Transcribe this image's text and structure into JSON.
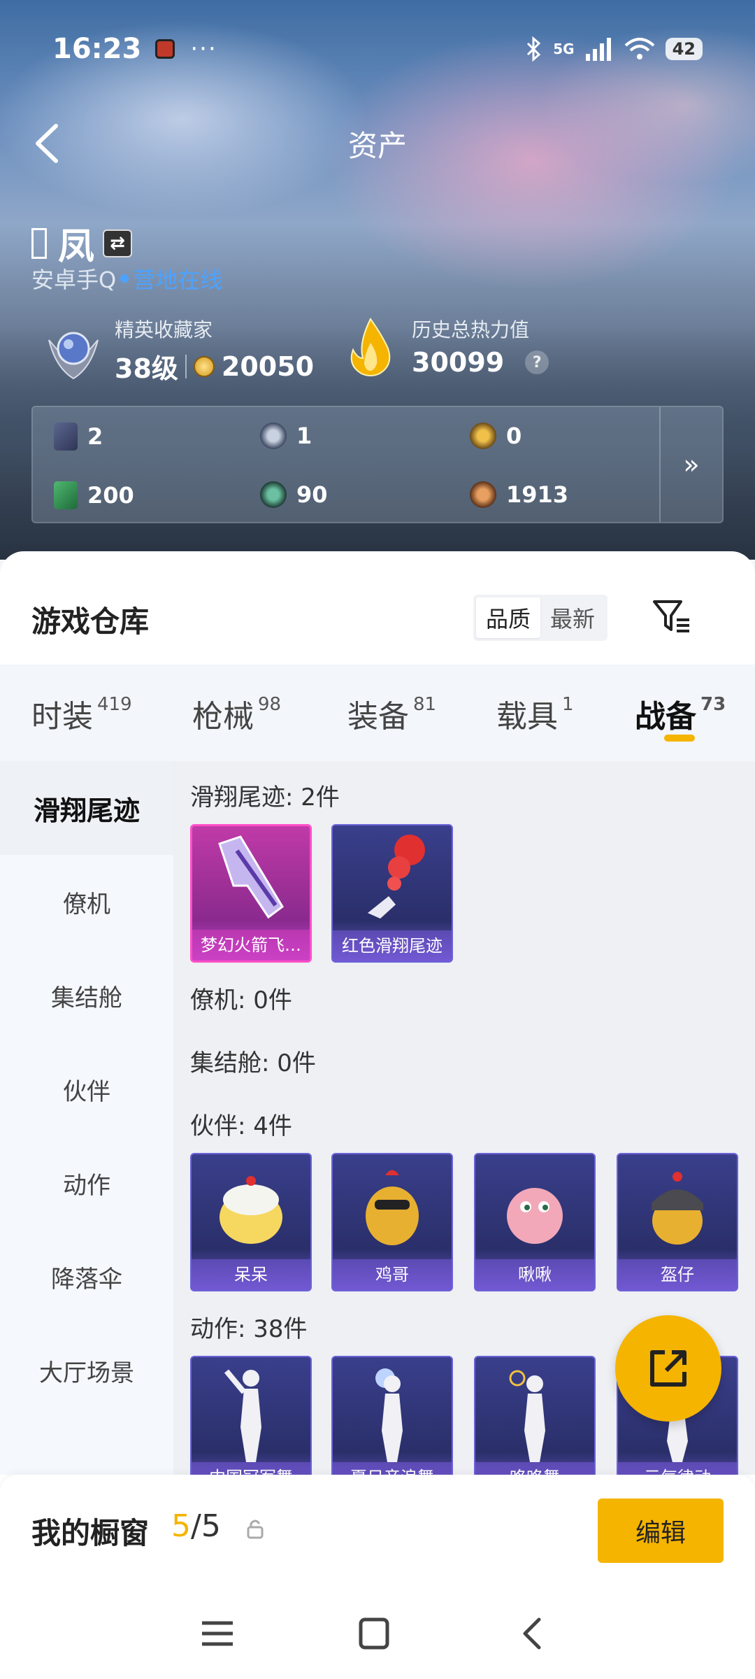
{
  "status_bar": {
    "time": "16:23",
    "dots": "···",
    "network": "5G",
    "battery": "42"
  },
  "header": {
    "title": "资产"
  },
  "user": {
    "name": "凤",
    "platform": "安卓手Q",
    "online_text": "营地在线",
    "rank_title": "精英收藏家",
    "level": "38级",
    "points": "20050",
    "heat_label": "历史总热力值",
    "heat_value": "30099",
    "help": "?"
  },
  "resources": [
    "2",
    "1",
    "0",
    "200",
    "90",
    "1913"
  ],
  "resources_more": "»",
  "warehouse": {
    "title": "游戏仓库",
    "sort_options": [
      "品质",
      "最新"
    ],
    "sort_active": "品质"
  },
  "tabs": [
    {
      "label": "时装",
      "count": "419"
    },
    {
      "label": "枪械",
      "count": "98"
    },
    {
      "label": "装备",
      "count": "81"
    },
    {
      "label": "载具",
      "count": "1"
    },
    {
      "label": "战备",
      "count": "73"
    }
  ],
  "active_tab": "战备",
  "sidebar": [
    "滑翔尾迹",
    "僚机",
    "集结舱",
    "伙伴",
    "动作",
    "降落伞",
    "大厅场景"
  ],
  "sections": {
    "glide": {
      "title": "滑翔尾迹: 2件",
      "items": [
        "梦幻火箭飞…",
        "红色滑翔尾迹"
      ]
    },
    "wingman": {
      "title": "僚机: 0件"
    },
    "assembly": {
      "title": "集结舱: 0件"
    },
    "partner": {
      "title": "伙伴: 4件",
      "items": [
        "呆呆",
        "鸡哥",
        "啾啾",
        "盔仔"
      ]
    },
    "emote": {
      "title": "动作: 38件",
      "items": [
        "中国冠军舞",
        "夏日音浪舞",
        "咯咯舞",
        "元气律动"
      ]
    }
  },
  "showcase": {
    "label": "我的橱窗",
    "current": "5",
    "total": "/5",
    "edit": "编辑"
  },
  "colors": {
    "accent": "#f5b400",
    "online": "#4da3ff",
    "card_purple": "#3a3f8c",
    "card_pink": "#c03aa8"
  }
}
